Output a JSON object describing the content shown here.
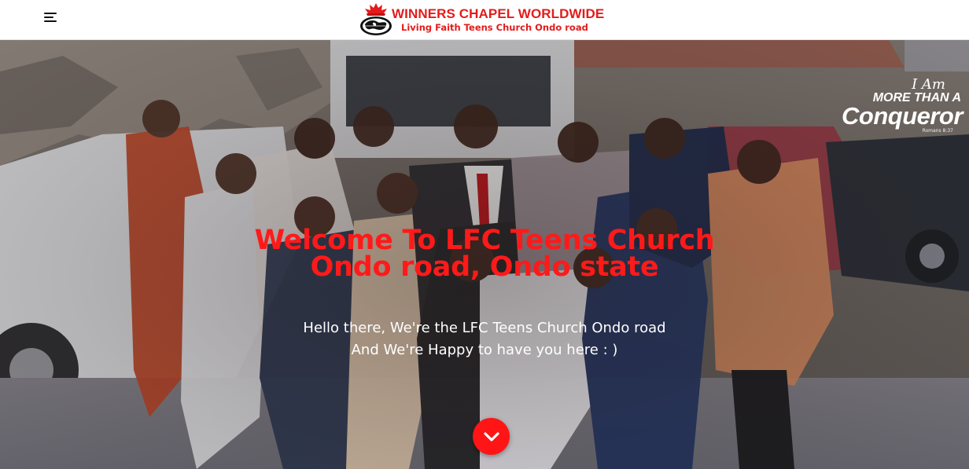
{
  "header": {
    "brand_title": "WINNERS CHAPEL WORLDWIDE",
    "brand_subtitle": "Living Faith Teens Church Ondo road",
    "menu_icon": "hamburger-menu-icon",
    "logo_icon": "globe-flame-logo"
  },
  "hero": {
    "title_line1": "Welcome To LFC Teens Church",
    "title_line2": "Ondo road, Ondo state",
    "text_line1": "Hello there, We're the LFC Teens Church Ondo road",
    "text_line2": "And We're Happy to have you here : )",
    "scroll_icon": "chevron-down-icon",
    "badge": {
      "line1": "I Am",
      "line2": "MORE THAN A",
      "line3": "Conqueror",
      "line4": "Romans 8:37"
    }
  },
  "colors": {
    "accent": "#e41b1b",
    "title_red": "#ff1a1a",
    "button_red": "#ff1515",
    "text_white": "#ffffff"
  }
}
